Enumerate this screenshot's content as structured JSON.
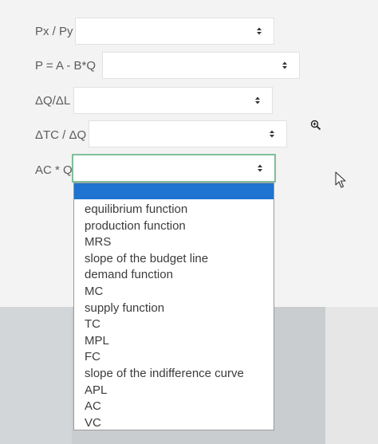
{
  "form": {
    "rows": [
      {
        "label": "Px / Py",
        "value": ""
      },
      {
        "label": "P = A - B*Q",
        "value": ""
      },
      {
        "label": "ΔQ/ΔL",
        "value": ""
      },
      {
        "label": "ΔTC / ΔQ",
        "value": ""
      },
      {
        "label": "AC * Q",
        "value": ""
      }
    ]
  },
  "dropdown": {
    "selected": "",
    "options": [
      "equilibrium function",
      "production function",
      "MRS",
      "slope of the budget line",
      "demand function",
      "MC",
      "supply function",
      "TC",
      "MPL",
      "FC",
      "slope of the indifference curve",
      "APL",
      "AC",
      "VC"
    ]
  },
  "icons": {
    "select_arrow": "updown-chevron-icon",
    "zoom_cursor": "zoom-cursor-icon",
    "pointer_cursor": "pointer-cursor-icon"
  },
  "colors": {
    "highlight": "#1e74d0",
    "focus_border": "#7fbf9a"
  }
}
